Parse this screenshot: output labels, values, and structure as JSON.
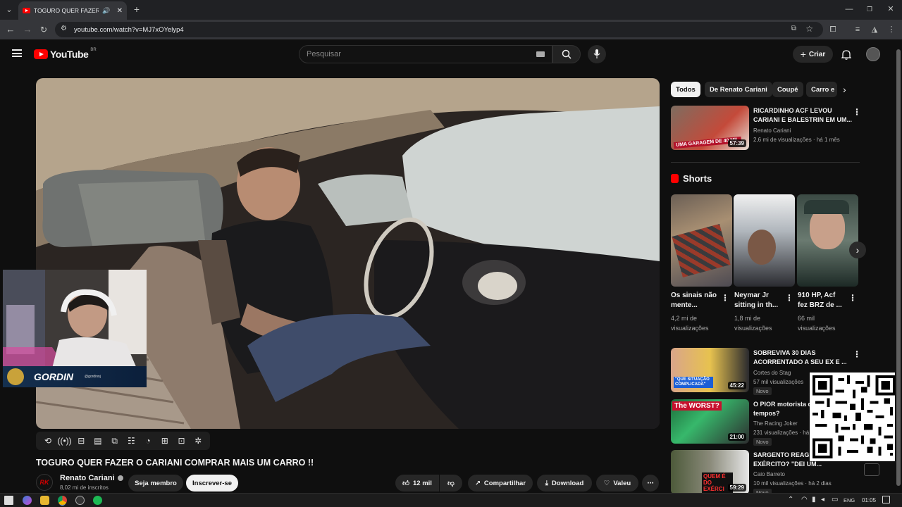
{
  "browser": {
    "tab_title": "TOGURO QUER FAZER O CA",
    "url": "youtube.com/watch?v=MJ7xOYelyp4"
  },
  "youtube": {
    "logo_text": "YouTube",
    "region": "BR",
    "search_placeholder": "Pesquisar",
    "create_label": "Criar"
  },
  "video": {
    "title": "TOGURO QUER FAZER O CARIANI COMPRAR MAIS UM CARRO !!",
    "overlay_name": "GORDIN",
    "overlay_handle": "@gordinnj",
    "channel_name": "Renato Cariani",
    "channel_initials": "RK",
    "subscribers": "8,02 mi de inscritos",
    "member_label": "Seja membro",
    "subscribe_label": "Inscrever-se",
    "likes": "12 mil",
    "share_label": "Compartilhar",
    "download_label": "Download",
    "thanks_label": "Valeu"
  },
  "chips": [
    "Todos",
    "De Renato Cariani",
    "Coupé",
    "Carro e"
  ],
  "recommendations": [
    {
      "title": "RICARDINHO ACF LEVOU CARIANI E BALESTRIN EM UM...",
      "channel": "Renato Cariani",
      "meta": "2,6 mi de visualizações · há 1 mês",
      "duration": "57:39",
      "thumb_text": "UMA GARAGEM DE 40 MIL"
    },
    {
      "title": "SOBREVIVA 30 DIAS ACORRENTADO A SEU EX E ...",
      "channel": "Cortes do Stag",
      "meta": "57 mil visualizações",
      "badge": "Novo",
      "duration": "45:22",
      "thumb_text": "\"QUE SITUAÇÃO COMPLICADA\""
    },
    {
      "title": "O PIOR motorista de todos os tempos?",
      "channel": "The Racing Joker",
      "meta": "231 visualizações · há",
      "badge": "Novo",
      "duration": "21:00",
      "thumb_text": "The WORST?"
    },
    {
      "title": "SARGENTO REAGE AO EXÉRCITO? \"DEI UM...",
      "channel": "Caio Barreto",
      "meta": "10 mil visualizações · há 2 dias",
      "badge": "Novo",
      "duration": "59:29",
      "thumb_text": "QUEM É DO EXÉRCI"
    }
  ],
  "shorts": {
    "heading": "Shorts",
    "items": [
      {
        "title": "Os sinais não mente...",
        "views": "4,2 mi de visualizações"
      },
      {
        "title": "Neymar Jr sitting in th...",
        "views": "1,8 mi de visualizações"
      },
      {
        "title": "910 HP, Acf fez BRZ de ...",
        "views": "66 mil visualizações"
      }
    ]
  },
  "taskbar": {
    "lang": "ENG",
    "time": "01:05"
  }
}
